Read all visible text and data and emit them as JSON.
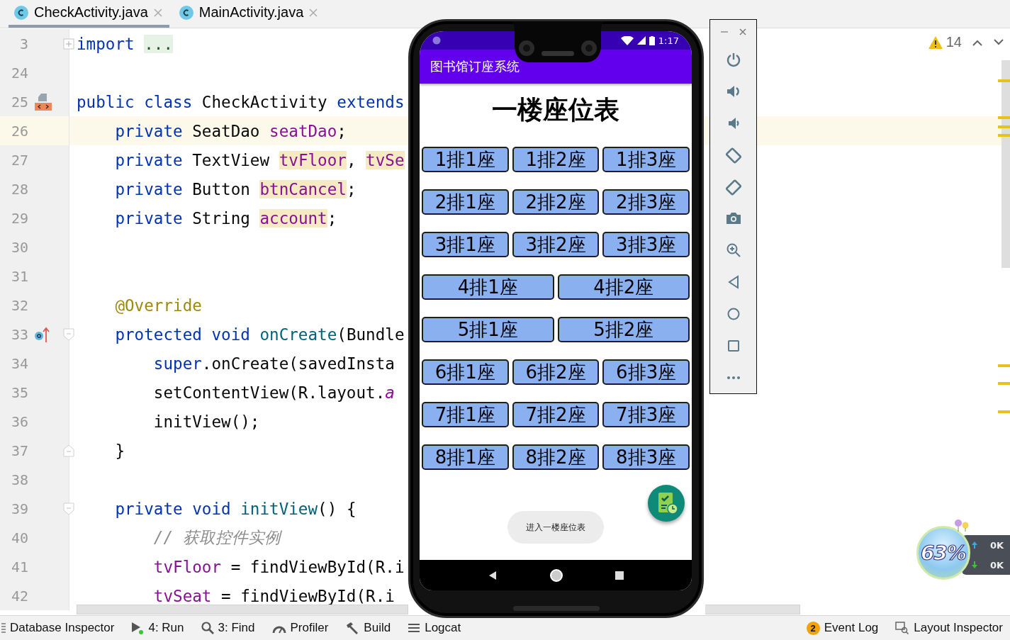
{
  "editor_tabs": [
    {
      "label": "CheckActivity.java",
      "selected": true
    },
    {
      "label": "MainActivity.java",
      "selected": false
    }
  ],
  "code_lines": [
    {
      "number": "3",
      "markers": [
        {
          "kind": "fold-collapsed"
        }
      ],
      "tokens": [
        {
          "text": "import ",
          "kind": "keyword"
        },
        {
          "text": "...",
          "kind": "folded"
        }
      ]
    },
    {
      "number": "24"
    },
    {
      "number": "25",
      "markers": [
        {
          "kind": "class"
        }
      ],
      "tokens": [
        {
          "text": "public class",
          "kind": "keyword"
        },
        {
          "text": " CheckActivity "
        },
        {
          "text": "extends",
          "kind": "keyword"
        }
      ]
    },
    {
      "number": "26",
      "current": true,
      "tokens": [
        {
          "text": "    private",
          "kind": "keyword"
        },
        {
          "text": " SeatDao "
        },
        {
          "text": "seatDao",
          "kind": "field"
        },
        {
          "text": ";"
        }
      ]
    },
    {
      "number": "27",
      "tokens": [
        {
          "text": "    private",
          "kind": "keyword"
        },
        {
          "text": " TextView "
        },
        {
          "text": "tvFloor",
          "kind": "field",
          "highlight": true
        },
        {
          "text": ", "
        },
        {
          "text": "tvSe",
          "kind": "field",
          "highlight": true
        }
      ]
    },
    {
      "number": "28",
      "tokens": [
        {
          "text": "    private",
          "kind": "keyword"
        },
        {
          "text": " Button "
        },
        {
          "text": "btnCancel",
          "kind": "field",
          "highlight": true
        },
        {
          "text": ";"
        }
      ]
    },
    {
      "number": "29",
      "tokens": [
        {
          "text": "    private",
          "kind": "keyword"
        },
        {
          "text": " String "
        },
        {
          "text": "account",
          "kind": "field",
          "highlight": true
        },
        {
          "text": ";"
        }
      ]
    },
    {
      "number": "30"
    },
    {
      "number": "31"
    },
    {
      "number": "32",
      "tokens": [
        {
          "text": "    @Override",
          "kind": "annotation"
        }
      ]
    },
    {
      "number": "33",
      "markers": [
        {
          "kind": "override"
        },
        {
          "kind": "fold-start"
        }
      ],
      "tokens": [
        {
          "text": "    protected void ",
          "kind": "keyword"
        },
        {
          "text": "onCreate",
          "kind": "method"
        },
        {
          "text": "(Bundle"
        }
      ]
    },
    {
      "number": "34",
      "tokens": [
        {
          "text": "        super",
          "kind": "keyword"
        },
        {
          "text": ".onCreate(savedInsta"
        }
      ]
    },
    {
      "number": "35",
      "tokens": [
        {
          "text": "        setContentView(R.layout."
        },
        {
          "text": "a",
          "kind": "static"
        }
      ]
    },
    {
      "number": "36",
      "tokens": [
        {
          "text": "        initView();"
        }
      ]
    },
    {
      "number": "37",
      "markers": [
        {
          "kind": "fold-end"
        }
      ],
      "tokens": [
        {
          "text": "    }"
        }
      ]
    },
    {
      "number": "38"
    },
    {
      "number": "39",
      "markers": [
        {
          "kind": "fold-start"
        }
      ],
      "tokens": [
        {
          "text": "    private void ",
          "kind": "keyword"
        },
        {
          "text": "initView",
          "kind": "method"
        },
        {
          "text": "() {"
        }
      ]
    },
    {
      "number": "40",
      "tokens": [
        {
          "text": "        // 获取控件实例",
          "kind": "comment"
        }
      ]
    },
    {
      "number": "41",
      "tokens": [
        {
          "text": "        tvFloor",
          "kind": "field"
        },
        {
          "text": " = findViewById(R.i"
        }
      ]
    },
    {
      "number": "42",
      "tokens": [
        {
          "text": "        tvSeat",
          "kind": "field"
        },
        {
          "text": " = findViewById(R.i"
        }
      ]
    }
  ],
  "inspections": {
    "warnings": "14"
  },
  "phone": {
    "status_time": "1:17",
    "app_title": "图书馆订座系统",
    "heading": "一楼座位表",
    "seat_rows": [
      [
        "1排1座",
        "1排2座",
        "1排3座"
      ],
      [
        "2排1座",
        "2排2座",
        "2排3座"
      ],
      [
        "3排1座",
        "3排2座",
        "3排3座"
      ],
      [
        "4排1座",
        "4排2座"
      ],
      [
        "5排1座",
        "5排2座"
      ],
      [
        "6排1座",
        "6排2座",
        "6排3座"
      ],
      [
        "7排1座",
        "7排2座",
        "7排3座"
      ],
      [
        "8排1座",
        "8排2座",
        "8排3座"
      ]
    ],
    "toast": "进入一楼座位表"
  },
  "network_widget": {
    "percent": "63%",
    "upload": "0K",
    "download": "0K"
  },
  "tool_windows_left": [
    {
      "label": "Database Inspector"
    },
    {
      "label": "4: Run"
    },
    {
      "label": "3: Find"
    },
    {
      "label": "Profiler"
    },
    {
      "label": "Build"
    },
    {
      "label": "Logcat"
    }
  ],
  "tool_windows_right": [
    {
      "label": "Event Log",
      "badge": "2"
    },
    {
      "label": "Layout Inspector"
    }
  ]
}
